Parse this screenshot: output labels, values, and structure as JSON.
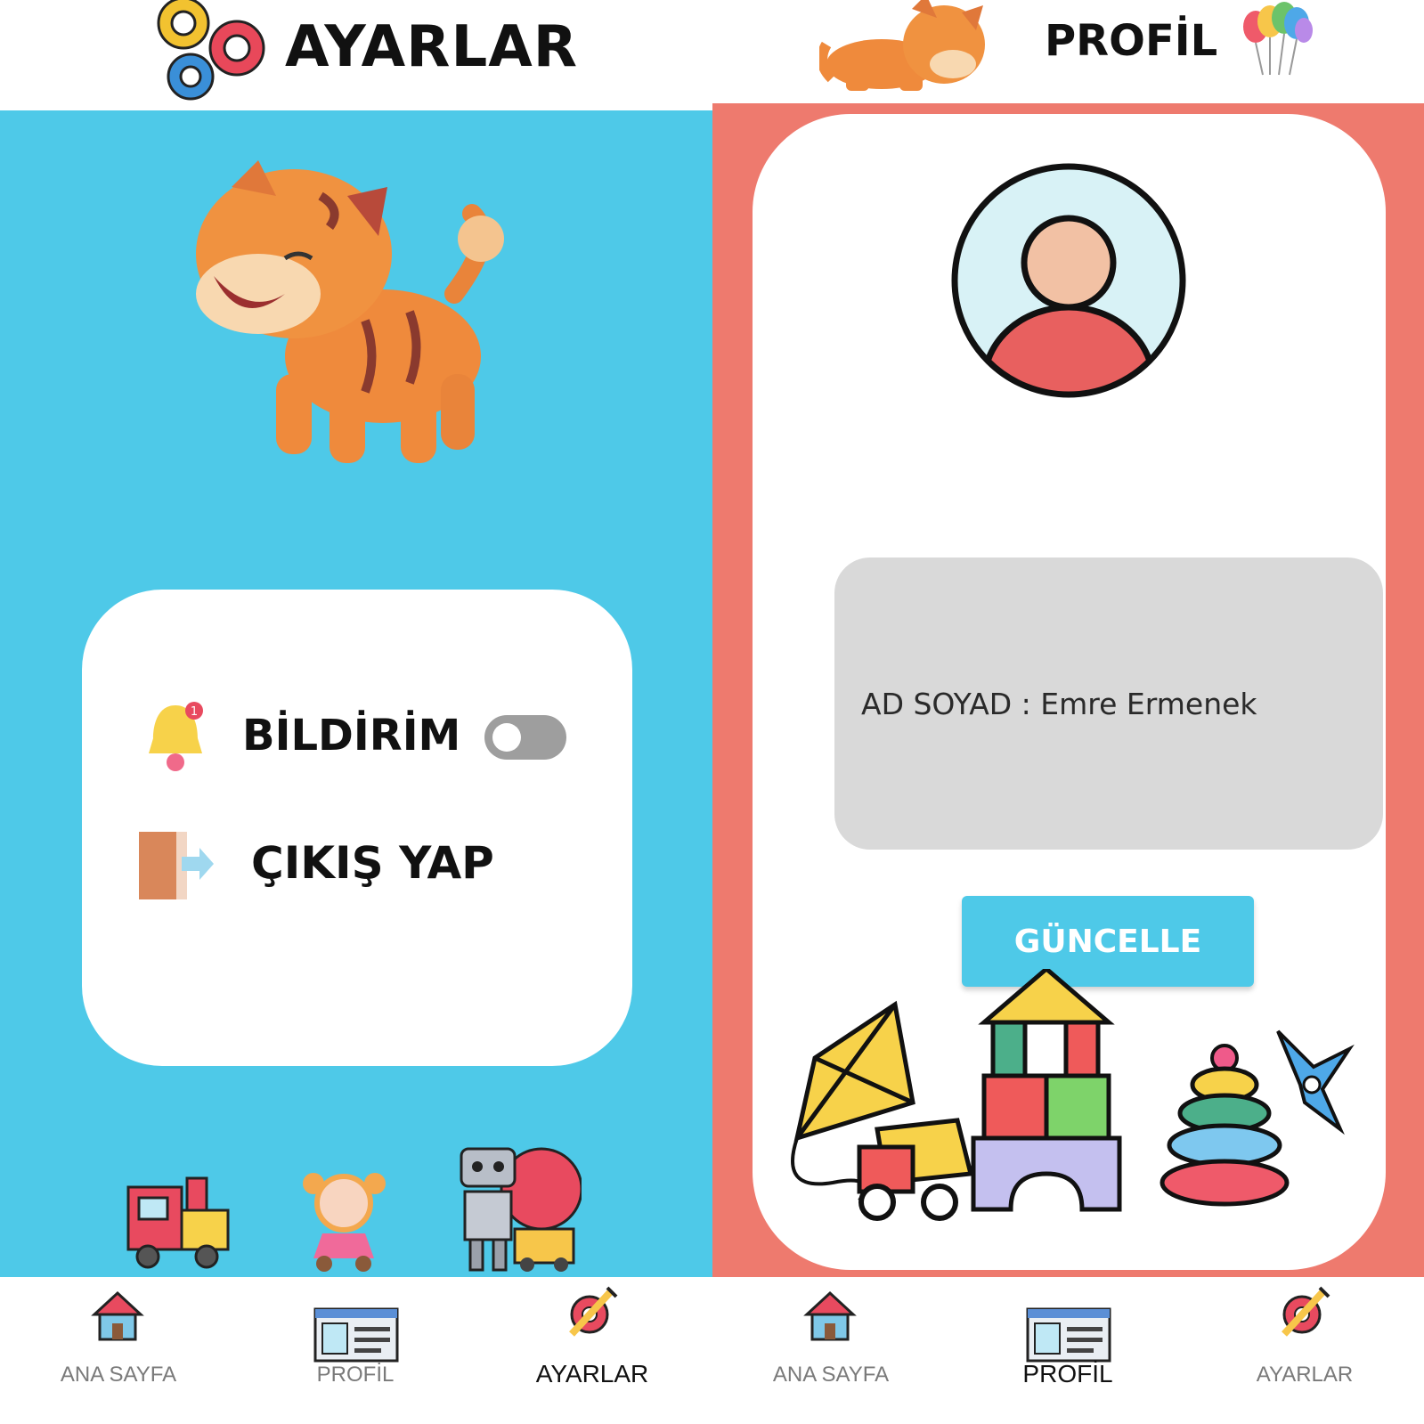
{
  "colors": {
    "settings_bg": "#4ec9e8",
    "profile_bg": "#ee7a6e",
    "card_bg": "#ffffff",
    "toggle_off": "#9e9e9e",
    "button_bg": "#4ec9e8",
    "name_box_bg": "#d9d9d9"
  },
  "settings": {
    "title": "AYARLAR",
    "header_icon": "gears-icon",
    "mascot_icon": "tiger-icon",
    "items": [
      {
        "label": "BİLDİRİM",
        "icon": "bell-icon",
        "control": "toggle",
        "toggle_on": false
      },
      {
        "label": "ÇIKIŞ YAP",
        "icon": "exit-door-icon"
      }
    ],
    "toys": [
      "train-icon",
      "doll-icon",
      "robot-icon"
    ],
    "nav": [
      {
        "label": "ANA SAYFA",
        "icon": "house-icon",
        "active": false
      },
      {
        "label": "PROFİL",
        "icon": "profile-card-icon",
        "active": false
      },
      {
        "label": "AYARLAR",
        "icon": "settings-tools-icon",
        "active": true
      }
    ]
  },
  "profile": {
    "title": "PROFİL",
    "header_left_icon": "tiger-icon",
    "header_right_icon": "balloons-icon",
    "avatar_icon": "user-avatar-icon",
    "name_field": "AD SOYAD : Emre Ermenek",
    "update_button": "GÜNCELLE",
    "toys_icon": "toys-illustration-icon",
    "nav": [
      {
        "label": "ANA SAYFA",
        "icon": "house-icon",
        "active": false
      },
      {
        "label": "PROFİL",
        "icon": "profile-card-icon",
        "active": true
      },
      {
        "label": "AYARLAR",
        "icon": "settings-tools-icon",
        "active": false
      }
    ]
  }
}
